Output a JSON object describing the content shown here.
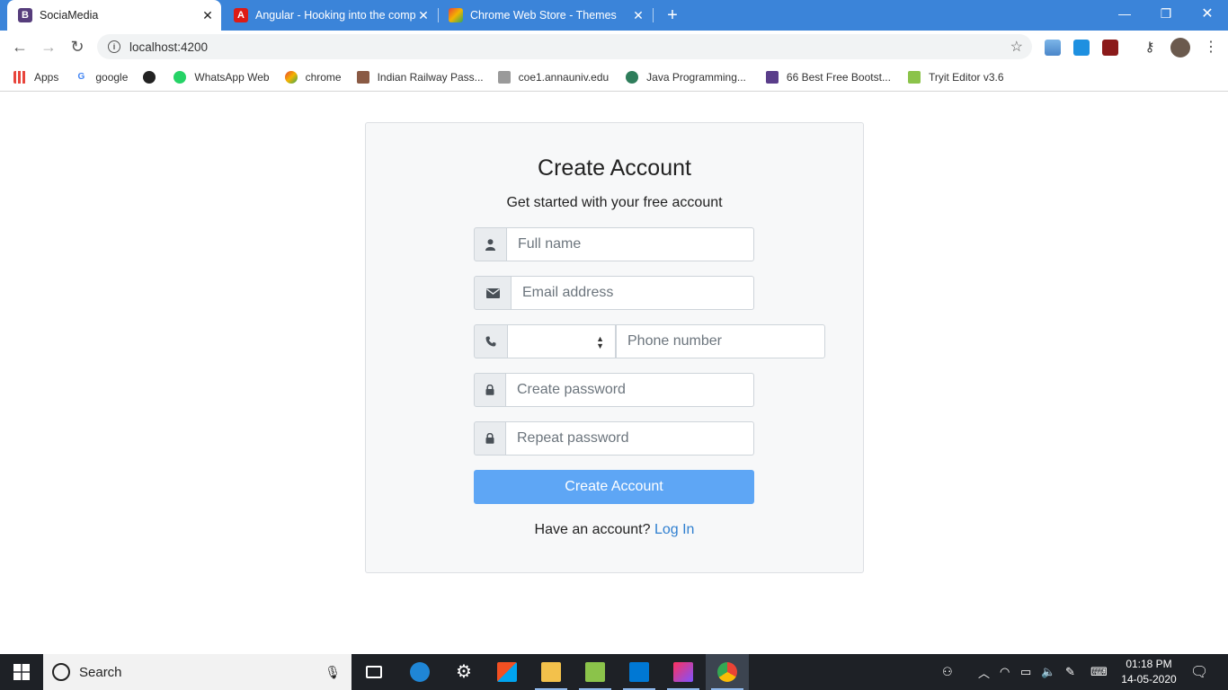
{
  "browser": {
    "tabs": [
      {
        "title": "SociaMedia",
        "favicon": "B",
        "favicon_color": "#563d7c"
      },
      {
        "title": "Angular - Hooking into the comp",
        "favicon": "A",
        "favicon_color": "#dd1b16"
      },
      {
        "title": "Chrome Web Store - Themes",
        "favicon": "",
        "favicon_color": "#f4b400"
      }
    ],
    "new_tab_label": "+",
    "url": "localhost:4200",
    "bookmarks": [
      {
        "label": "Apps",
        "icon": "apps-grid-icon",
        "color": "#e8453c"
      },
      {
        "label": "google",
        "icon": "google-icon",
        "color": "#4285f4"
      },
      {
        "label": "",
        "icon": "globe-icon",
        "color": "#222222"
      },
      {
        "label": "WhatsApp Web",
        "icon": "whatsapp-icon",
        "color": "#25d366"
      },
      {
        "label": "chrome",
        "icon": "chrome-icon",
        "color": "#f4b400"
      },
      {
        "label": "Indian Railway Pass...",
        "icon": "railway-icon",
        "color": "#8a5a44"
      },
      {
        "label": "coe1.annauniv.edu",
        "icon": "university-icon",
        "color": "#7a7a7a"
      },
      {
        "label": "Java Programming...",
        "icon": "java-icon",
        "color": "#2e7d5b"
      },
      {
        "label": "66 Best Free Bootst...",
        "icon": "colorlib-icon",
        "color": "#5a3d8a"
      },
      {
        "label": "Tryit Editor v3.6",
        "icon": "w3schools-icon",
        "color": "#8bc34a"
      }
    ]
  },
  "form": {
    "title": "Create Account",
    "subtitle": "Get started with your free account",
    "full_name_placeholder": "Full name",
    "email_placeholder": "Email address",
    "country_code_value": "",
    "phone_placeholder": "Phone number",
    "password_placeholder": "Create password",
    "repeat_password_placeholder": "Repeat password",
    "submit_label": "Create Account",
    "have_account_text": "Have an account?",
    "login_label": "Log In",
    "accent_color": "#5ea6f5"
  },
  "taskbar": {
    "search_placeholder": "Search",
    "time": "01:18 PM",
    "date": "14-05-2020"
  }
}
